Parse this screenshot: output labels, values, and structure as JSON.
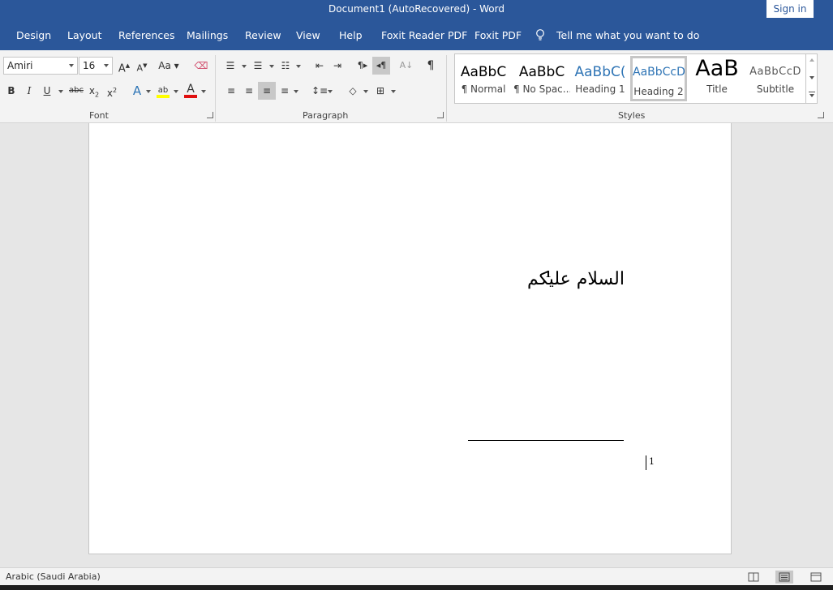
{
  "window": {
    "title": "Document1 (AutoRecovered)  -  Word",
    "sign_in": "Sign in"
  },
  "tabs": [
    "Design",
    "Layout",
    "References",
    "Mailings",
    "Review",
    "View",
    "Help",
    "Foxit Reader PDF",
    "Foxit PDF"
  ],
  "tell_me": "Tell me what you want to do",
  "font": {
    "name": "Amiri",
    "size": "16",
    "group_label": "Font"
  },
  "paragraph": {
    "group_label": "Paragraph"
  },
  "styles": {
    "group_label": "Styles",
    "items": [
      {
        "preview": "AaBbC",
        "name": "¶ Normal"
      },
      {
        "preview": "AaBbC",
        "name": "¶ No Spac..."
      },
      {
        "preview": "AaBbC(",
        "name": "Heading 1"
      },
      {
        "preview": "AaBbCcD",
        "name": "Heading 2"
      },
      {
        "preview": "AaB",
        "name": "Title"
      },
      {
        "preview": "AaBbCcD",
        "name": "Subtitle"
      }
    ],
    "selected": "Heading 2"
  },
  "document": {
    "body_text": "السلام عليكم",
    "footnote_ref": "1",
    "footnote_number": "1"
  },
  "status": {
    "language": "Arabic (Saudi Arabia)"
  },
  "colors": {
    "brand": "#2b579a",
    "highlight": "#ffff00",
    "font_color": "#e01010"
  }
}
